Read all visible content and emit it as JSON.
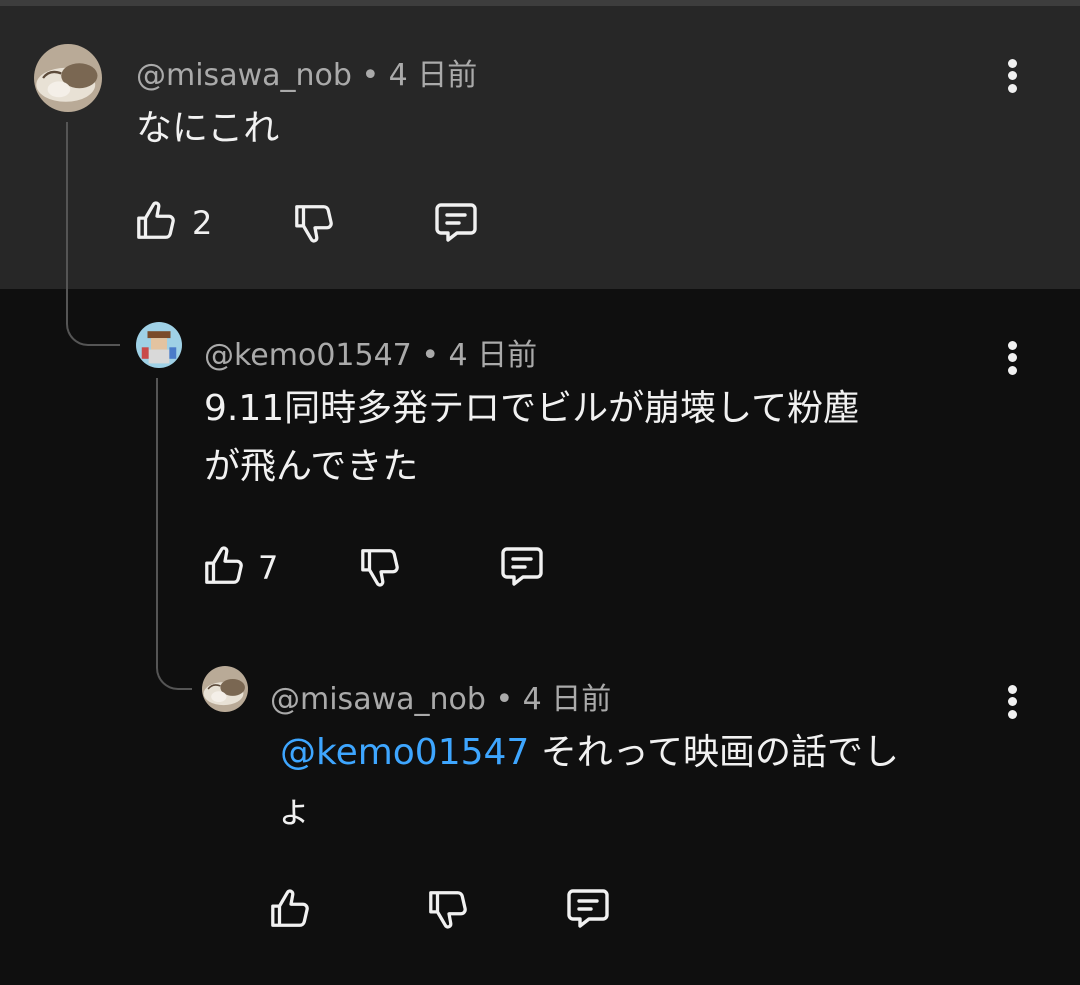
{
  "comments": [
    {
      "author": "@misawa_nob",
      "time": "• 4 日前",
      "text": "なにこれ",
      "likes": "2",
      "highlighted": true
    },
    {
      "author": "@kemo01547",
      "time": "• 4 日前",
      "text_line1": "9.11同時多発テロでビルが崩壊して粉塵",
      "text_line2": "が飛んできた",
      "likes": "7"
    },
    {
      "author": "@misawa_nob",
      "time": "• 4 日前",
      "mention": "@kemo01547",
      "text_line1": "それって映画の話でし",
      "text_line2": "ょ",
      "likes": ""
    }
  ],
  "icons": {
    "like": "thumb-up-icon",
    "dislike": "thumb-down-icon",
    "reply": "reply-comment-icon",
    "menu": "more-vert-icon"
  },
  "colors": {
    "background": "#0f0f0f",
    "highlight": "#272727",
    "mention": "#3ea6ff",
    "meta": "#aaaaaa"
  }
}
